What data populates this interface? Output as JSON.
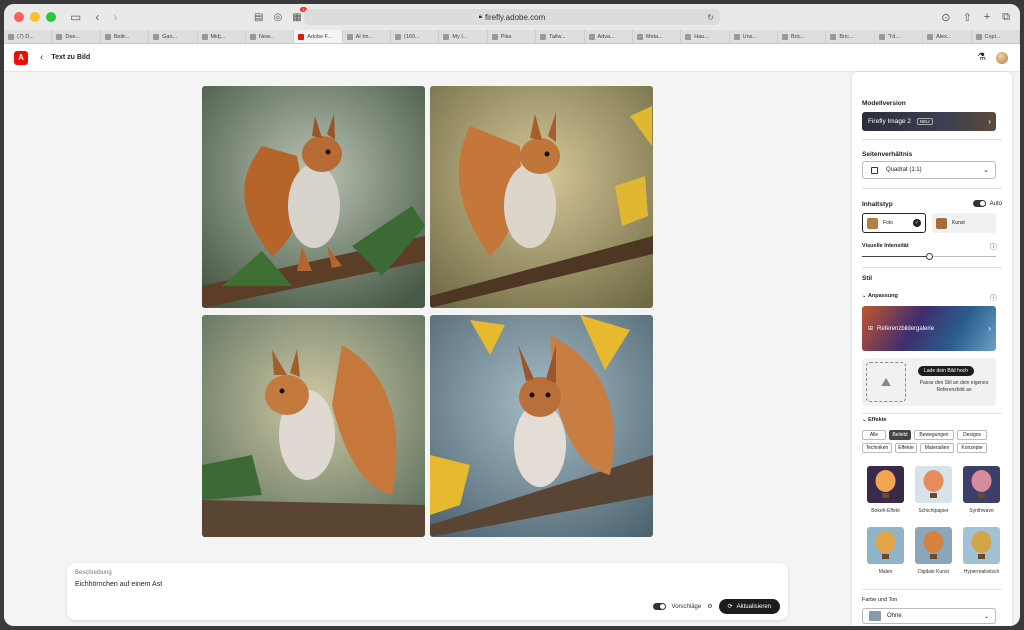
{
  "browser": {
    "url": "firefly.adobe.com",
    "notification_count": "1",
    "tabs": [
      {
        "label": "(7) D..."
      },
      {
        "label": "Dee..."
      },
      {
        "label": "Beitr..."
      },
      {
        "label": "Gan..."
      },
      {
        "label": "Midj..."
      },
      {
        "label": "New..."
      },
      {
        "label": "Adobe F...",
        "active": true
      },
      {
        "label": "AI Im..."
      },
      {
        "label": "(160..."
      },
      {
        "label": "My I..."
      },
      {
        "label": "Pika"
      },
      {
        "label": "Tailw..."
      },
      {
        "label": "Adva..."
      },
      {
        "label": "Meta..."
      },
      {
        "label": "Hau..."
      },
      {
        "label": "Uns..."
      },
      {
        "label": "Bric..."
      },
      {
        "label": "Bric..."
      },
      {
        "label": "\"I'd..."
      },
      {
        "label": "Alex..."
      },
      {
        "label": "Copi..."
      }
    ]
  },
  "header": {
    "page_title": "Text zu Bild"
  },
  "prompt": {
    "label": "Beschreibung",
    "text": "Eichhörnchen auf einem Ast",
    "suggestions_label": "Vorschläge",
    "update_label": "Aktualisieren"
  },
  "panel": {
    "model_section": "Modellversion",
    "model_name": "Firefly Image 2",
    "model_badge": "NEU",
    "aspect_section": "Seitenverhältnis",
    "aspect_value": "Quadrat (1:1)",
    "content_section": "Inhaltstyp",
    "auto_label": "Auto",
    "content_photo": "Foto",
    "content_art": "Kunst",
    "intensity_label": "Visuelle Intensität",
    "intensity_value": 0.5,
    "style_section": "Stil",
    "adjust_label": "Anpassung",
    "ref_gallery": "Referenzbildergalerie",
    "upload_button": "Lade dein Bild hoch",
    "upload_text": "Passe den Stil an dein eigenes Referenzbild an",
    "effects_label": "Effekte",
    "chips_row1": [
      "Alle",
      "Beliebt",
      "Bewegungen",
      "Designs"
    ],
    "chips_row2": [
      "Techniken",
      "Effekte",
      "Materialien",
      "Konzepte"
    ],
    "selected_chip": "Beliebt",
    "effects": [
      {
        "label": "Bokeh-Effekt"
      },
      {
        "label": "Schichtpapier"
      },
      {
        "label": "Synthwave"
      },
      {
        "label": "Malen"
      },
      {
        "label": "Digitale Kunst"
      },
      {
        "label": "Hyperrealistisch"
      }
    ],
    "color_section": "Farbe und Ton",
    "color_value": "Ohne"
  },
  "colors": {
    "accent": "#eb1000",
    "dark_button": "#1d1d1d"
  }
}
